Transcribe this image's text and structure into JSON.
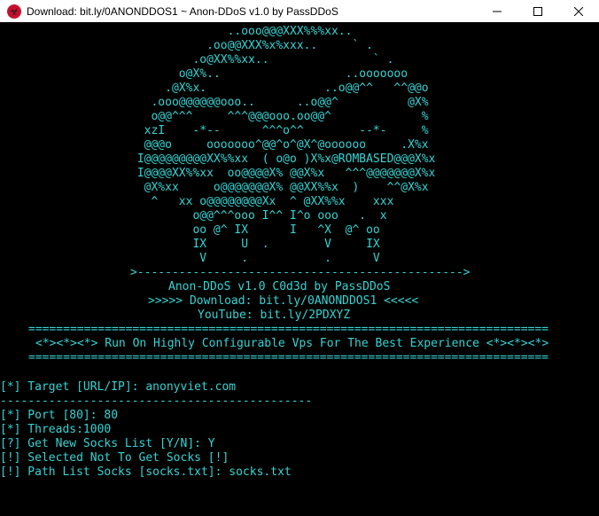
{
  "window": {
    "title": "Download: bit.ly/0ANONDDOS1 ~ Anon-DDoS v1.0 by PassDDoS",
    "icon": "hazard-icon",
    "controls": [
      "minimize-icon",
      "maximize-icon",
      "close-icon"
    ]
  },
  "colors": {
    "console_bg": "#000000",
    "console_text": "#35d4d4",
    "titlebar_bg": "#ffffff"
  },
  "ascii_art": [
    "              ..ooo@@@XXX%%%xx..",
    "           .oo@@XXX%x%xxx..     ` .",
    "         .o@XX%%xx..               ` .",
    "       o@X%..                  ..ooooooo",
    "     .@X%x.                 ..o@@^^   ^^@@o",
    "   .ooo@@@@@@ooo..      ..o@@^          @X%",
    "   o@@^^^     ^^^@@@ooo.oo@@^             %",
    "  xzI    -*--      ^^^o^^        --*-     %",
    "  @@@o     ooooooo^@@^o^@X^@oooooo     .X%x",
    " I@@@@@@@@@XX%%xx  ( o@o )X%x@ROMBASED@@@X%x",
    " I@@@@XX%%xx  oo@@@@X% @@X%x   ^^^@@@@@@@X%x",
    "  @X%xx     o@@@@@@@X% @@XX%%x  )    ^^@X%x",
    "   ^   xx o@@@@@@@@Xx  ^ @XX%%x    xxx",
    "         o@@^^^ooo I^^ I^o ooo   .  x",
    "         oo @^ IX      I   ^X  @^ oo",
    "         IX     U  .        V     IX",
    "          V     .           .      V"
  ],
  "separator_arrow": ">----------------------------------------------->",
  "banner": {
    "credit": "Anon-DDoS v1.0 C0d3d by PassDDoS",
    "download": ">>>>> Download: bit.ly/0ANONDDOS1 <<<<<",
    "youtube": "YouTube: bit.ly/2PDXYZ"
  },
  "rule_line": "===========================================================================",
  "motto": "<*><*><*> Run On Highly Configurable Vps For The Best Experience <*><*><*>",
  "prompts": {
    "target": "[*] Target [URL/IP]: anonyviet.com",
    "divider": "---------------------------------------------",
    "port": "[*] Port [80]: 80",
    "threads": "[*] Threads:1000",
    "socks_list": "[?] Get New Socks List [Y/N]: Y",
    "selected": "[!] Selected Not To Get Socks [!]",
    "path": "[!] Path List Socks [socks.txt]: socks.txt"
  }
}
